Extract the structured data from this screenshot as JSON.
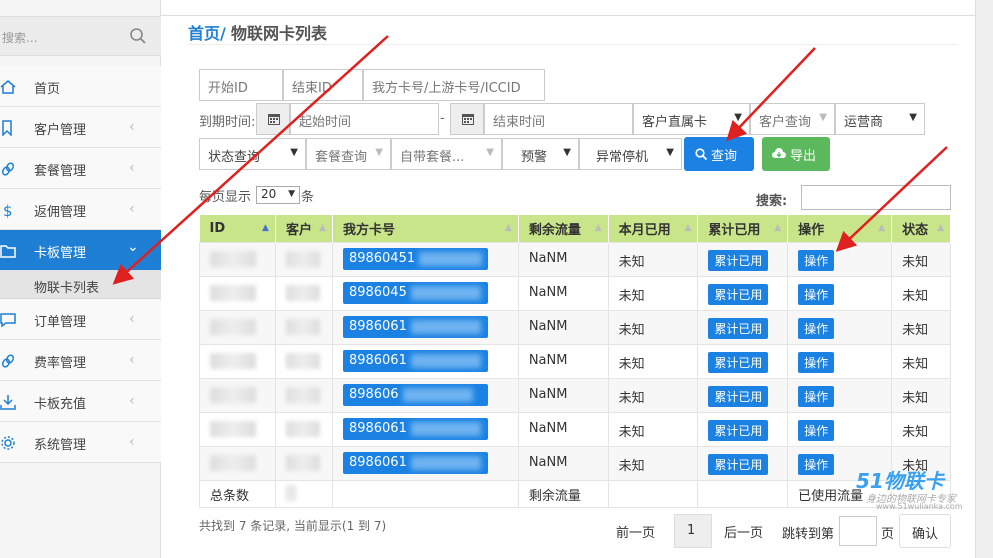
{
  "sidebar": {
    "search_placeholder": "搜索...",
    "items": [
      {
        "label": "首页",
        "icon": "home-icon"
      },
      {
        "label": "客户管理",
        "icon": "bookmark-icon"
      },
      {
        "label": "套餐管理",
        "icon": "link-icon"
      },
      {
        "label": "返佣管理",
        "icon": "dollar-icon"
      },
      {
        "label": "卡板管理",
        "icon": "folder-icon"
      },
      {
        "label": "订单管理",
        "icon": "comment-icon"
      },
      {
        "label": "费率管理",
        "icon": "link-icon"
      },
      {
        "label": "卡板充值",
        "icon": "download-icon"
      },
      {
        "label": "系统管理",
        "icon": "gear-icon"
      }
    ],
    "sub_item": "物联卡列表"
  },
  "breadcrumb": {
    "home": "首页",
    "sep": "/",
    "current": "物联网卡列表"
  },
  "filters": {
    "start_id": "开始ID",
    "end_id": "结束ID",
    "card_no": "我方卡号/上游卡号/ICCID",
    "expire_label": "到期时间:",
    "start_time": "起始时间",
    "end_time": "结束时间",
    "dash": "-",
    "customer_card": "客户直属卡",
    "customer_query": "客户查询",
    "operator": "运营商",
    "status_query": "状态查询",
    "package_query": "套餐查询",
    "own_package": "自带套餐...",
    "warning": "预警",
    "abnormal_stop": "异常停机",
    "query_button": "查询",
    "export_button": "导出"
  },
  "table_controls": {
    "per_page_prefix": "每页显示",
    "per_page_value": "20",
    "per_page_suffix": "条",
    "search_label": "搜索:"
  },
  "table": {
    "headers": [
      "ID",
      "客户",
      "我方卡号",
      "剩余流量",
      "本月已用",
      "累计已用",
      "操作",
      "状态"
    ],
    "rows": [
      {
        "card": "89860451",
        "remaining": "NaNM",
        "month": "未知",
        "total_btn": "累计已用",
        "op_btn": "操作",
        "status": "未知"
      },
      {
        "card": "8986045",
        "remaining": "NaNM",
        "month": "未知",
        "total_btn": "累计已用",
        "op_btn": "操作",
        "status": "未知"
      },
      {
        "card": "8986061",
        "remaining": "NaNM",
        "month": "未知",
        "total_btn": "累计已用",
        "op_btn": "操作",
        "status": "未知"
      },
      {
        "card": "8986061",
        "remaining": "NaNM",
        "month": "未知",
        "total_btn": "累计已用",
        "op_btn": "操作",
        "status": "未知"
      },
      {
        "card": "898606",
        "remaining": "NaNM",
        "month": "未知",
        "total_btn": "累计已用",
        "op_btn": "操作",
        "status": "未知"
      },
      {
        "card": "8986061",
        "remaining": "NaNM",
        "month": "未知",
        "total_btn": "累计已用",
        "op_btn": "操作",
        "status": "未知"
      },
      {
        "card": "8986061",
        "remaining": "NaNM",
        "month": "未知",
        "total_btn": "累计已用",
        "op_btn": "操作",
        "status": "未知"
      }
    ],
    "footer": {
      "total": "总条数",
      "remaining": "剩余流量",
      "used": "已使用流量"
    }
  },
  "pager": {
    "info": "共找到 7 条记录, 当前显示(1 到 7)",
    "prev": "前一页",
    "current": "1",
    "next": "后一页",
    "jump_label": "跳转到第",
    "page_unit": "页",
    "confirm": "确认"
  },
  "watermark": {
    "logo": "51物联卡",
    "slogan": "身边的物联网卡专家",
    "url": "www.51wulianka.com"
  },
  "colors": {
    "primary": "#1b82e3",
    "header_green": "#c9e58a",
    "export_green": "#5cb85c",
    "arrow_red": "#e0201e"
  }
}
